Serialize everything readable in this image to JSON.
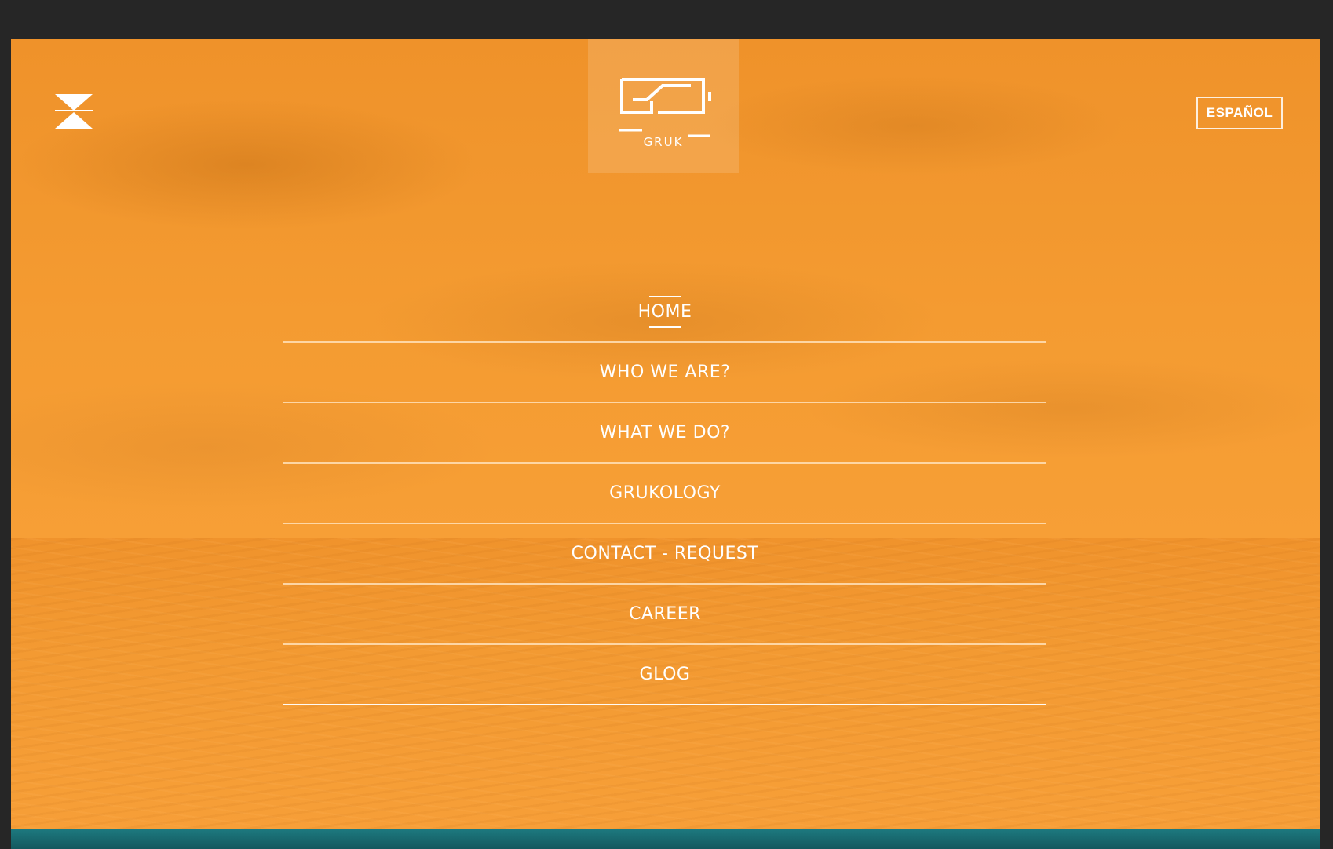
{
  "header": {
    "logo_text": "GRUK",
    "language_button": "ESPAÑOL"
  },
  "nav": {
    "items": [
      {
        "label": "HOME",
        "active": true
      },
      {
        "label": "WHO WE ARE?",
        "active": false
      },
      {
        "label": "WHAT WE DO?",
        "active": false
      },
      {
        "label": "GRUKOLOGY",
        "active": false
      },
      {
        "label": "CONTACT - REQUEST",
        "active": false
      },
      {
        "label": "CAREER",
        "active": false
      },
      {
        "label": "GLOG",
        "active": false
      }
    ]
  },
  "icons": {
    "menu_toggle": "hourglass-close-icon",
    "logo": "gruk-logo-icon"
  },
  "colors": {
    "overlay_orange": "#f59a2e",
    "text": "#ffffff",
    "footer_teal": "#1d7a80",
    "outer_background": "#262626"
  }
}
